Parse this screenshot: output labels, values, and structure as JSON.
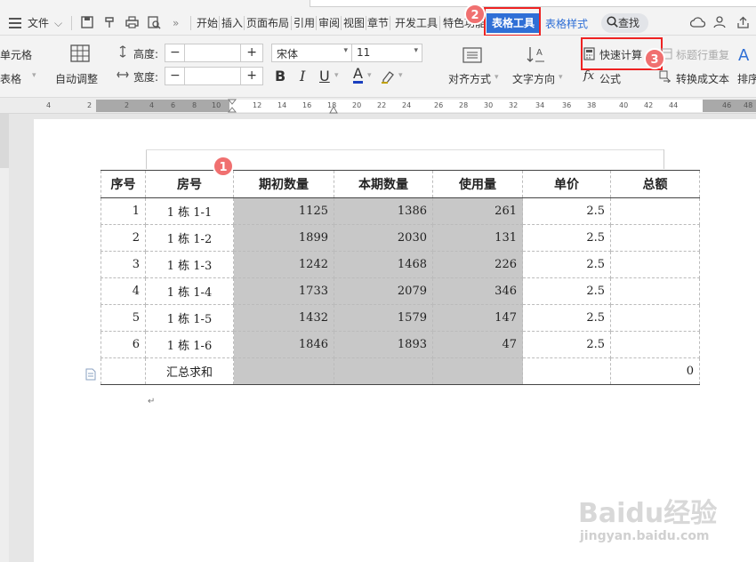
{
  "menu": {
    "file": "文件",
    "tabs": [
      "开始",
      "插入",
      "页面布局",
      "引用",
      "审阅",
      "视图",
      "章节",
      "开发工具",
      "特色功能"
    ],
    "active_tab": "表格工具",
    "style_tab": "表格样式",
    "search": "查找"
  },
  "ribbon": {
    "cell_label": "单元格",
    "table_label": "表格",
    "auto_adjust": "自动调整",
    "height_label": "高度:",
    "width_label": "宽度:",
    "font_name": "宋体",
    "font_size": "11",
    "align": "对齐方式",
    "text_dir": "文字方向",
    "quick_calc": "快速计算",
    "formula": "公式",
    "repeat_title": "标题行重复",
    "convert_text": "转换成文本",
    "sort": "排序"
  },
  "ruler": [
    "4",
    "2",
    "2",
    "4",
    "6",
    "8",
    "10",
    "12",
    "14",
    "16",
    "18",
    "20",
    "22",
    "24",
    "26",
    "28",
    "30",
    "32",
    "34",
    "36",
    "38",
    "40",
    "42",
    "44",
    "46",
    "48"
  ],
  "table": {
    "headers": [
      "序号",
      "房号",
      "期初数量",
      "本期数量",
      "使用量",
      "单价",
      "总额"
    ],
    "rows": [
      [
        "1",
        "1 栋 1-1",
        "1125",
        "1386",
        "261",
        "2.5",
        ""
      ],
      [
        "2",
        "1 栋 1-2",
        "1899",
        "2030",
        "131",
        "2.5",
        ""
      ],
      [
        "3",
        "1 栋 1-3",
        "1242",
        "1468",
        "226",
        "2.5",
        ""
      ],
      [
        "4",
        "1 栋 1-4",
        "1733",
        "2079",
        "346",
        "2.5",
        ""
      ],
      [
        "5",
        "1 栋 1-5",
        "1432",
        "1579",
        "147",
        "2.5",
        ""
      ],
      [
        "6",
        "1 栋 1-6",
        "1846",
        "1893",
        "47",
        "2.5",
        ""
      ],
      [
        "",
        "汇总求和",
        "",
        "",
        "",
        "",
        "0"
      ]
    ]
  },
  "badges": [
    "1",
    "2",
    "3"
  ],
  "watermark": {
    "brand": "Baidu经验",
    "url": "jingyan.baidu.com"
  },
  "colors": {
    "accent": "#2f6fd6",
    "highlight": "#e22222",
    "badge": "#f07070",
    "shade": "#c8c8c8"
  }
}
